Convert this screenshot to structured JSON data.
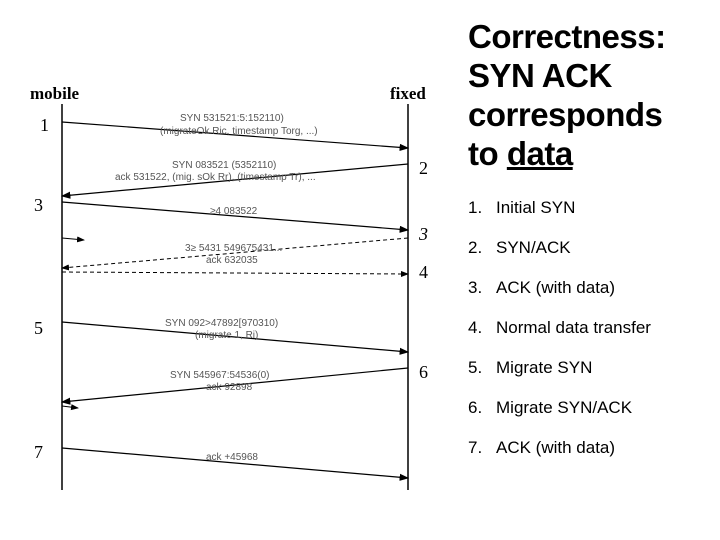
{
  "actors": {
    "mobile": "mobile",
    "fixed": "fixed"
  },
  "seq_numbers": {
    "n1": "1",
    "n2": "2",
    "n3": "3",
    "n3b": "3",
    "n4": "4",
    "n5": "5",
    "n6": "6",
    "n7": "7"
  },
  "messages": {
    "m1a": "SYN 531521:5:152110)",
    "m1b": "(migrateOk Ric, timestamp Torg, ...)",
    "m2a": "SYN 083521 (5352110)",
    "m2b": "ack 531522, (mig. sOk Rr), (timestamp Tr), ...",
    "m3": "≥4 083522",
    "m4a": "3≥ 5431 549675431...",
    "m4b": "ack 632035",
    "m5a": "SYN 092>47892[970310)",
    "m5b": "(migrate 1, Ri)",
    "m6a": "SYN 545967:54536(0)",
    "m6b": "ack 92898",
    "m7": "ack +45968"
  },
  "title_parts": {
    "line1": "Correctness:",
    "line2": "SYN ACK",
    "line3": "corresponds",
    "line4_a": "to ",
    "line4_b": "data"
  },
  "steps": [
    {
      "num": "1.",
      "text": "Initial SYN"
    },
    {
      "num": "2.",
      "text": "SYN/ACK"
    },
    {
      "num": "3.",
      "text": "ACK (with data)"
    },
    {
      "num": "4.",
      "text": "Normal data transfer"
    },
    {
      "num": "5.",
      "text": "Migrate SYN"
    },
    {
      "num": "6.",
      "text": "Migrate SYN/ACK"
    },
    {
      "num": "7.",
      "text": "ACK (with data)"
    }
  ]
}
